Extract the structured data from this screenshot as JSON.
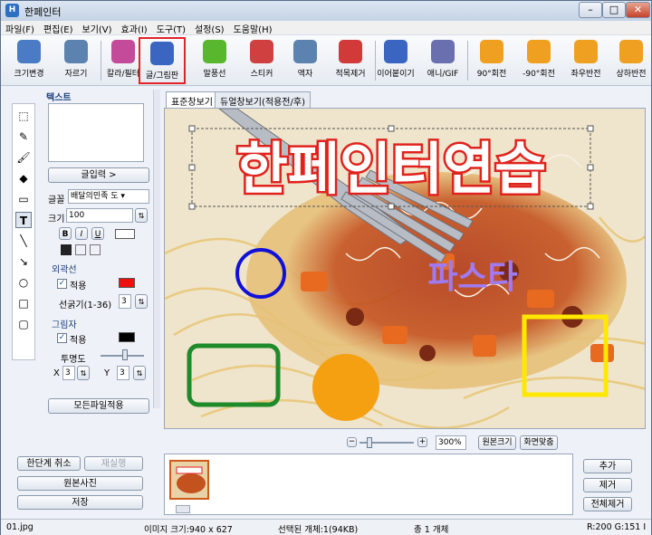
{
  "window": {
    "title": "한페인터"
  },
  "menu": [
    "파일(F)",
    "편집(E)",
    "보기(V)",
    "효과(I)",
    "도구(T)",
    "설정(S)",
    "도움말(H)"
  ],
  "toolbar": [
    {
      "label": "크기변경",
      "icon": "resize-icon",
      "color": "#4a7bc4"
    },
    {
      "label": "자르기",
      "icon": "crop-icon",
      "color": "#5c82b0"
    },
    {
      "label": "칼라/필터",
      "icon": "color-filter-icon",
      "color": "#c44a9a"
    },
    {
      "label": "글/그림판",
      "icon": "text-drawing-icon",
      "color": "#3a66c2"
    },
    {
      "label": "말풍선",
      "icon": "speech-bubble-icon",
      "color": "#59b72e"
    },
    {
      "label": "스티커",
      "icon": "sticker-icon",
      "color": "#d04040"
    },
    {
      "label": "액자",
      "icon": "frame-icon",
      "color": "#5c82b0"
    },
    {
      "label": "적목제거",
      "icon": "redeye-icon",
      "color": "#d23a3a"
    },
    {
      "label": "이어붙이기",
      "icon": "merge-icon",
      "color": "#3a66c2"
    },
    {
      "label": "애니/GIF",
      "icon": "gif-icon",
      "color": "#6a6fb0"
    },
    {
      "label": "90°회전",
      "icon": "rotate-cw-icon",
      "color": "#f0a020"
    },
    {
      "label": "-90°회전",
      "icon": "rotate-ccw-icon",
      "color": "#f0a020"
    },
    {
      "label": "좌우반전",
      "icon": "flip-h-icon",
      "color": "#f0a020"
    },
    {
      "label": "상하반전",
      "icon": "flip-v-icon",
      "color": "#f0a020"
    }
  ],
  "tools": [
    "select-icon",
    "pencil-icon",
    "brush-icon",
    "fill-icon",
    "eraser-icon",
    "text-icon",
    "line-icon",
    "arrow-icon",
    "circle-icon",
    "rect-icon",
    "roundrect-icon"
  ],
  "panel": {
    "text_header": "텍스트",
    "input_btn": "글입력 >",
    "font_label": "글꼴",
    "font_value": "배달의민족 도",
    "size_label": "크기",
    "size_value": "100",
    "outline_header": "외곽선",
    "outline_apply": "적용",
    "outline_color": "#ee1010",
    "thickness_label": "선굵기(1-36)",
    "thickness_value": "3",
    "shadow_header": "그림자",
    "shadow_apply": "적용",
    "shadow_color": "#000000",
    "opacity_label": "투명도",
    "x_label": "X",
    "x_value": "3",
    "y_label": "Y",
    "y_value": "3",
    "apply_all": "모든파일적용"
  },
  "tabs": [
    "표준창보기",
    "듀얼창보기(적용전/후)"
  ],
  "canvas": {
    "title_text": "한페인터연습",
    "subtitle_text": "파스타"
  },
  "zoom": {
    "value": "300%",
    "original": "원본크기",
    "fit": "화면맞춤"
  },
  "left_buttons": {
    "undo": "한단계 취소",
    "redo": "재실행",
    "original": "원본사진",
    "save": "저장"
  },
  "right_buttons": {
    "add": "추가",
    "remove": "제거",
    "remove_all": "전체제거"
  },
  "status": {
    "file": "01.jpg",
    "image_size": "이미지 크기:940 x 627",
    "selected": "선택된 개체:1(94KB)",
    "total": "총 1 개체",
    "color": "R:200 G:151 I"
  }
}
